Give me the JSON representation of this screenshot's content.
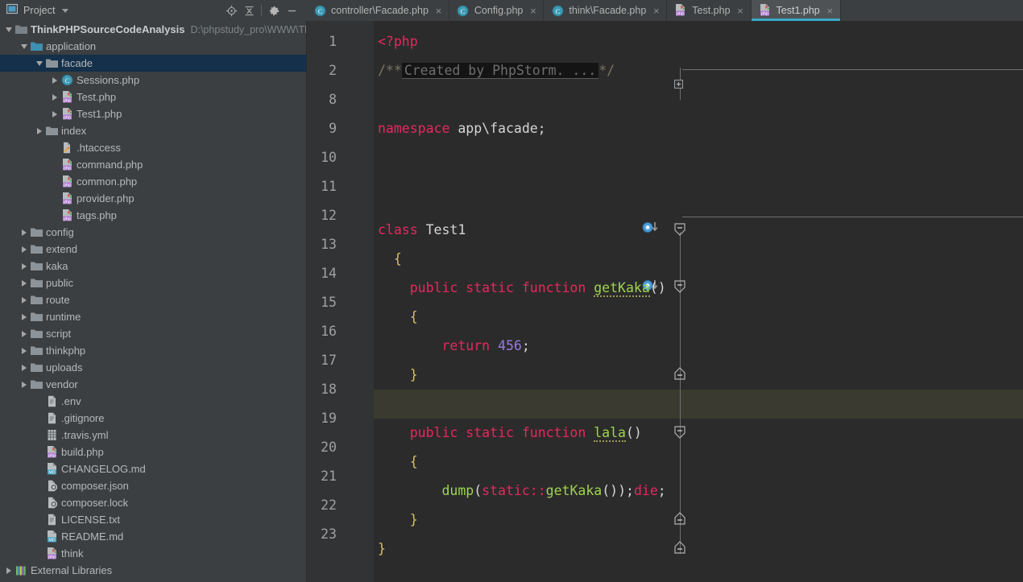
{
  "project_panel": {
    "title": "Project",
    "icon": "project-window-icon",
    "dropdown_icon": "chevron-down-icon",
    "tools": [
      {
        "name": "locate-icon",
        "label": "Select Opened File"
      },
      {
        "name": "collapse-all-icon",
        "label": "Collapse All"
      },
      {
        "name": "gear-icon",
        "label": "Settings"
      },
      {
        "name": "minimize-icon",
        "label": "Hide"
      }
    ]
  },
  "tabs": [
    {
      "label": "controller\\Facade.php",
      "icon": "php-class-icon",
      "active": false,
      "close_icon": "close-icon"
    },
    {
      "label": "Config.php",
      "icon": "php-class-icon",
      "active": false,
      "close_icon": "close-icon"
    },
    {
      "label": "think\\Facade.php",
      "icon": "php-class-icon",
      "active": false,
      "close_icon": "close-icon"
    },
    {
      "label": "Test.php",
      "icon": "php-file-icon",
      "active": false,
      "close_icon": "close-icon"
    },
    {
      "label": "Test1.php",
      "icon": "php-file-icon",
      "active": true,
      "close_icon": "close-icon"
    }
  ],
  "tree": [
    {
      "label": "ThinkPHPSourceCodeAnalysis",
      "path": "D:\\phpstudy_pro\\WWW\\Th",
      "indent": 0,
      "arrow": "open",
      "icon": "folder-module-icon",
      "bold": true,
      "selected": false
    },
    {
      "label": "application",
      "indent": 1,
      "arrow": "open",
      "icon": "folder-source-icon",
      "selected": false
    },
    {
      "label": "facade",
      "indent": 2,
      "arrow": "open",
      "icon": "folder-icon",
      "selected": true
    },
    {
      "label": "Sessions.php",
      "indent": 3,
      "arrow": "closed",
      "icon": "php-class-icon",
      "selected": false
    },
    {
      "label": "Test.php",
      "indent": 3,
      "arrow": "closed",
      "icon": "php-file-icon",
      "selected": false
    },
    {
      "label": "Test1.php",
      "indent": 3,
      "arrow": "closed",
      "icon": "php-file-icon",
      "selected": false
    },
    {
      "label": "index",
      "indent": 2,
      "arrow": "closed",
      "icon": "folder-icon",
      "selected": false
    },
    {
      "label": ".htaccess",
      "indent": 3,
      "arrow": "none",
      "icon": "htaccess-icon",
      "selected": false
    },
    {
      "label": "command.php",
      "indent": 3,
      "arrow": "none",
      "icon": "php-file-icon",
      "selected": false
    },
    {
      "label": "common.php",
      "indent": 3,
      "arrow": "none",
      "icon": "php-file-icon",
      "selected": false
    },
    {
      "label": "provider.php",
      "indent": 3,
      "arrow": "none",
      "icon": "php-file-icon",
      "selected": false
    },
    {
      "label": "tags.php",
      "indent": 3,
      "arrow": "none",
      "icon": "php-file-icon",
      "selected": false
    },
    {
      "label": "config",
      "indent": 1,
      "arrow": "closed",
      "icon": "folder-icon",
      "selected": false
    },
    {
      "label": "extend",
      "indent": 1,
      "arrow": "closed",
      "icon": "folder-icon",
      "selected": false
    },
    {
      "label": "kaka",
      "indent": 1,
      "arrow": "closed",
      "icon": "folder-icon",
      "selected": false
    },
    {
      "label": "public",
      "indent": 1,
      "arrow": "closed",
      "icon": "folder-icon",
      "selected": false
    },
    {
      "label": "route",
      "indent": 1,
      "arrow": "closed",
      "icon": "folder-icon",
      "selected": false
    },
    {
      "label": "runtime",
      "indent": 1,
      "arrow": "closed",
      "icon": "folder-icon",
      "selected": false
    },
    {
      "label": "script",
      "indent": 1,
      "arrow": "closed",
      "icon": "folder-icon",
      "selected": false
    },
    {
      "label": "thinkphp",
      "indent": 1,
      "arrow": "closed",
      "icon": "folder-icon",
      "selected": false
    },
    {
      "label": "uploads",
      "indent": 1,
      "arrow": "closed",
      "icon": "folder-icon",
      "selected": false
    },
    {
      "label": "vendor",
      "indent": 1,
      "arrow": "closed",
      "icon": "folder-icon",
      "selected": false
    },
    {
      "label": ".env",
      "indent": 2,
      "arrow": "none",
      "icon": "text-file-icon",
      "selected": false
    },
    {
      "label": ".gitignore",
      "indent": 2,
      "arrow": "none",
      "icon": "text-file-icon",
      "selected": false
    },
    {
      "label": ".travis.yml",
      "indent": 2,
      "arrow": "none",
      "icon": "yaml-file-icon",
      "selected": false
    },
    {
      "label": "build.php",
      "indent": 2,
      "arrow": "none",
      "icon": "php-file-icon",
      "selected": false
    },
    {
      "label": "CHANGELOG.md",
      "indent": 2,
      "arrow": "none",
      "icon": "markdown-file-icon",
      "selected": false
    },
    {
      "label": "composer.json",
      "indent": 2,
      "arrow": "none",
      "icon": "composer-file-icon",
      "selected": false
    },
    {
      "label": "composer.lock",
      "indent": 2,
      "arrow": "none",
      "icon": "composer-file-icon",
      "selected": false
    },
    {
      "label": "LICENSE.txt",
      "indent": 2,
      "arrow": "none",
      "icon": "text-file-icon",
      "selected": false
    },
    {
      "label": "README.md",
      "indent": 2,
      "arrow": "none",
      "icon": "markdown-file-icon",
      "selected": false
    },
    {
      "label": "think",
      "indent": 2,
      "arrow": "none",
      "icon": "php-file-icon",
      "selected": false
    },
    {
      "label": "External Libraries",
      "indent": 0,
      "arrow": "closed",
      "icon": "libraries-icon",
      "selected": false
    }
  ],
  "editor": {
    "line_numbers": [
      "1",
      "2",
      "8",
      "9",
      "10",
      "11",
      "12",
      "13",
      "14",
      "15",
      "16",
      "17",
      "18",
      "19",
      "20",
      "21",
      "22",
      "23"
    ],
    "current_line": "18",
    "folded_comment": "Created by PhpStorm. ...",
    "code": {
      "l1_php": "<?php",
      "l2_open": "/**",
      "l2_close": "*/",
      "l9_kw": "namespace",
      "l9_ns": "app\\facade;",
      "l12_kw": "class",
      "l12_name": "Test1",
      "l13_brace": "{",
      "l14_mods": "public static function",
      "l14_fn": "getKaka",
      "l14_parens": "()",
      "l15_brace": "{",
      "l16_kw": "return",
      "l16_num": "456",
      "l16_semi": ";",
      "l17_brace": "}",
      "l19_mods": "public static function",
      "l19_fn": "lala",
      "l19_parens": "()",
      "l20_brace": "{",
      "l21_dump": "dump",
      "l21_p1": "(",
      "l21_static": "static",
      "l21_colons": "::",
      "l21_getkaka": "getKaka",
      "l21_p2": "())",
      "l21_semi1": ";",
      "l21_die": "die",
      "l21_semi2": ";",
      "l22_brace": "}",
      "l23_brace": "}"
    }
  },
  "colors": {
    "keyword": "#e8275f",
    "function": "#9fd44d",
    "number": "#9a78e8",
    "text": "#d6d6d6",
    "comment": "#7a7562",
    "editor_bg": "#2b2b2b",
    "gutter_bg": "#313335",
    "panel_bg": "#3c3f41",
    "selection_bg": "#14304a",
    "current_line_bg": "#3a3a30",
    "tab_accent": "#3ba9c8"
  }
}
